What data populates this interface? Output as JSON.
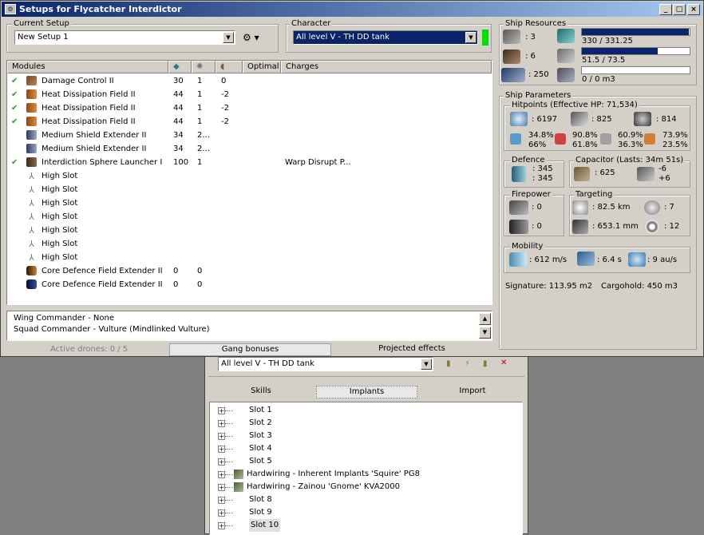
{
  "window": {
    "title": "Setups for Flycatcher Interdictor",
    "min": "_",
    "max": "□",
    "close": "×"
  },
  "current_setup": {
    "label": "Current Setup",
    "value": "New Setup 1"
  },
  "character": {
    "label": "Character",
    "value": "All level V - TH DD tank"
  },
  "modules": {
    "headers": [
      "Modules",
      "",
      "",
      "",
      "Optimal",
      "Charges"
    ],
    "rows": [
      {
        "check": "✔",
        "icon": "damage-control",
        "name": "Damage Control II",
        "c1": "30",
        "c2": "1",
        "c3": "0",
        "charges": ""
      },
      {
        "check": "✔",
        "icon": "heat-sink",
        "name": "Heat Dissipation Field II",
        "c1": "44",
        "c2": "1",
        "c3": "-2",
        "charges": ""
      },
      {
        "check": "✔",
        "icon": "heat-sink",
        "name": "Heat Dissipation Field II",
        "c1": "44",
        "c2": "1",
        "c3": "-2",
        "charges": ""
      },
      {
        "check": "✔",
        "icon": "heat-sink",
        "name": "Heat Dissipation Field II",
        "c1": "44",
        "c2": "1",
        "c3": "-2",
        "charges": ""
      },
      {
        "check": "",
        "icon": "shield-extender",
        "name": "Medium Shield Extender II",
        "c1": "34",
        "c2": "2...",
        "c3": "",
        "charges": ""
      },
      {
        "check": "",
        "icon": "shield-extender",
        "name": "Medium Shield Extender II",
        "c1": "34",
        "c2": "2...",
        "c3": "",
        "charges": ""
      },
      {
        "check": "✔",
        "icon": "launcher",
        "name": "Interdiction Sphere Launcher I",
        "c1": "100",
        "c2": "1",
        "c3": "",
        "charges": "Warp Disrupt P..."
      },
      {
        "check": "",
        "icon": "slot",
        "name": "High Slot",
        "c1": "",
        "c2": "",
        "c3": "",
        "charges": ""
      },
      {
        "check": "",
        "icon": "slot",
        "name": "High Slot",
        "c1": "",
        "c2": "",
        "c3": "",
        "charges": ""
      },
      {
        "check": "",
        "icon": "slot",
        "name": "High Slot",
        "c1": "",
        "c2": "",
        "c3": "",
        "charges": ""
      },
      {
        "check": "",
        "icon": "slot",
        "name": "High Slot",
        "c1": "",
        "c2": "",
        "c3": "",
        "charges": ""
      },
      {
        "check": "",
        "icon": "slot",
        "name": "High Slot",
        "c1": "",
        "c2": "",
        "c3": "",
        "charges": ""
      },
      {
        "check": "",
        "icon": "slot",
        "name": "High Slot",
        "c1": "",
        "c2": "",
        "c3": "",
        "charges": ""
      },
      {
        "check": "",
        "icon": "slot",
        "name": "High Slot",
        "c1": "",
        "c2": "",
        "c3": "",
        "charges": ""
      },
      {
        "check": "",
        "icon": "core-defence-a",
        "name": "Core Defence Field Extender II",
        "c1": "0",
        "c2": "0",
        "c3": "",
        "charges": ""
      },
      {
        "check": "",
        "icon": "core-defence-b",
        "name": "Core Defence Field Extender II",
        "c1": "0",
        "c2": "0",
        "c3": "",
        "charges": ""
      }
    ]
  },
  "gang": {
    "lines": [
      "Wing Commander - None",
      "Squad Commander - Vulture (Mindlinked Vulture)"
    ],
    "active_drones": "Active drones: 0 / 5",
    "gang_bonuses": "Gang bonuses",
    "projected": "Projected effects"
  },
  "resources": {
    "label": "Ship Resources",
    "turrets": ": 3",
    "launchers": ": 6",
    "drone_bay": ": 250",
    "cpu": "330 / 331.25",
    "cpu_frac": 0.996,
    "power": "51.5 / 73.5",
    "power_frac": 0.7,
    "drone_bw": "0 / 0 m3",
    "drone_frac": 0
  },
  "params": {
    "label": "Ship Parameters",
    "hitpoints": {
      "label": "Hitpoints (Effective HP: 71,534)",
      "shield": ": 6197",
      "armor": ": 825",
      "hull": ": 814",
      "em_a": "34.8%",
      "em_b": "66%",
      "therm_a": "90.8%",
      "therm_b": "61.8%",
      "kin_a": "60.9%",
      "kin_b": "36.3%",
      "exp_a": "73.9%",
      "exp_b": "23.5%"
    },
    "defence": {
      "label": "Defence",
      "v1": ": 345",
      "v2": ": 345"
    },
    "capacitor": {
      "label": "Capacitor (Lasts: 34m 51s)",
      "amount": ": 625",
      "delta1": "-6",
      "delta2": "+6"
    },
    "firepower": {
      "label": "Firepower",
      "turret": ": 0",
      "missile": ": 0"
    },
    "targeting": {
      "label": "Targeting",
      "range": ": 82.5 km",
      "max_targets": ": 7",
      "resolution": ": 653.1 mm",
      "sensor": ": 12"
    },
    "mobility": {
      "label": "Mobility",
      "speed": ": 612 m/s",
      "align": ": 6.4 s",
      "warp": ": 9 au/s"
    },
    "signature": "Signature: 113.95 m2",
    "cargohold": "Cargohold: 450 m3"
  },
  "second": {
    "character": "All level V - TH DD tank",
    "tabs": [
      "Skills",
      "Implants",
      "Import"
    ],
    "slots": [
      "Slot 1",
      "Slot 2",
      "Slot 3",
      "Slot 4",
      "Slot 5",
      "Hardwiring - Inherent Implants 'Squire' PG8",
      "Hardwiring - Zainou 'Gnome' KVA2000",
      "Slot 8",
      "Slot 9",
      "Slot 10"
    ]
  },
  "colors": {
    "title_start": "#0a246a",
    "accent_green": "#00e000",
    "bar_fill": "#0a246a",
    "check": "#2c9a2c"
  }
}
